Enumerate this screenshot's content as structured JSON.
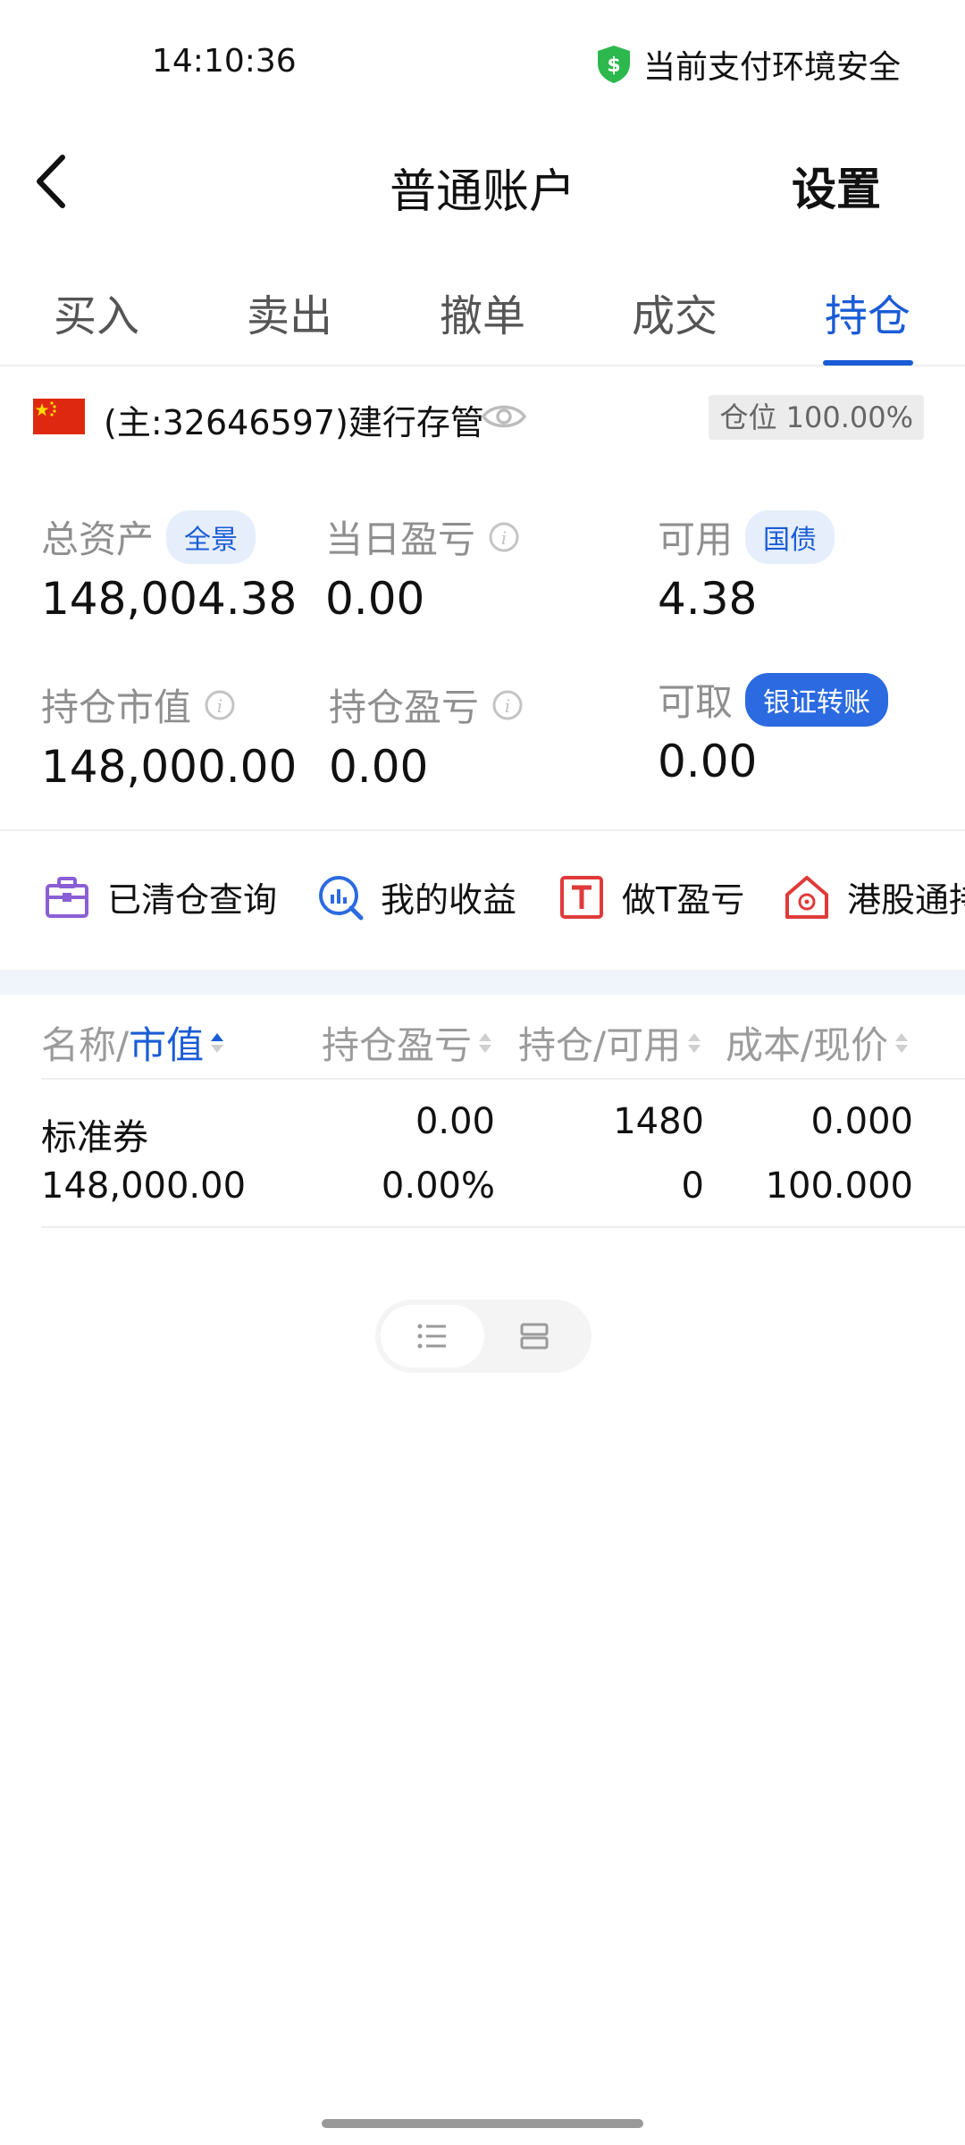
{
  "status_bar": {
    "time": "14:10:36",
    "secure_text": "当前支付环境安全",
    "shield_color": "#2db84d"
  },
  "nav": {
    "title": "普通账户",
    "settings": "设置"
  },
  "tabs": [
    {
      "label": "买入"
    },
    {
      "label": "卖出"
    },
    {
      "label": "撤单"
    },
    {
      "label": "成交"
    },
    {
      "label": "持仓",
      "active": true
    }
  ],
  "account": {
    "name": "(主:32646597)建行存管",
    "position_badge": "仓位 100.00%"
  },
  "assets": {
    "total": {
      "label": "总资产",
      "chip": "全景",
      "value": "148,004.38"
    },
    "daily_pnl": {
      "label": "当日盈亏",
      "value": "0.00"
    },
    "available": {
      "label": "可用",
      "chip": "国债",
      "value": "4.38"
    },
    "market_value": {
      "label": "持仓市值",
      "value": "148,000.00"
    },
    "position_pnl": {
      "label": "持仓盈亏",
      "value": "0.00"
    },
    "withdrawable": {
      "label": "可取",
      "chip": "银证转账",
      "value": "0.00"
    }
  },
  "shortcuts": [
    {
      "label": "已清仓查询",
      "icon": "briefcase-icon",
      "color": "#8a5fd6"
    },
    {
      "label": "我的收益",
      "icon": "chart-search-icon",
      "color": "#2b6ae0"
    },
    {
      "label": "做T盈亏",
      "icon": "t-box-icon",
      "color": "#e03a3a"
    },
    {
      "label": "港股通持",
      "icon": "hk-home-icon",
      "color": "#e03a3a"
    }
  ],
  "table": {
    "headers": {
      "name": "名称/",
      "name_highlight": "市值",
      "pnl": "持仓盈亏",
      "qty": "持仓/可用",
      "cost": "成本/现价"
    },
    "rows": [
      {
        "name": "标准券",
        "market_value": "148,000.00",
        "pnl": "0.00",
        "pnl_pct": "0.00%",
        "holding": "1480",
        "available": "0",
        "cost": "0.000",
        "price": "100.000"
      }
    ]
  },
  "colors": {
    "accent": "#1a5cd6",
    "muted": "#8f8f8f"
  }
}
